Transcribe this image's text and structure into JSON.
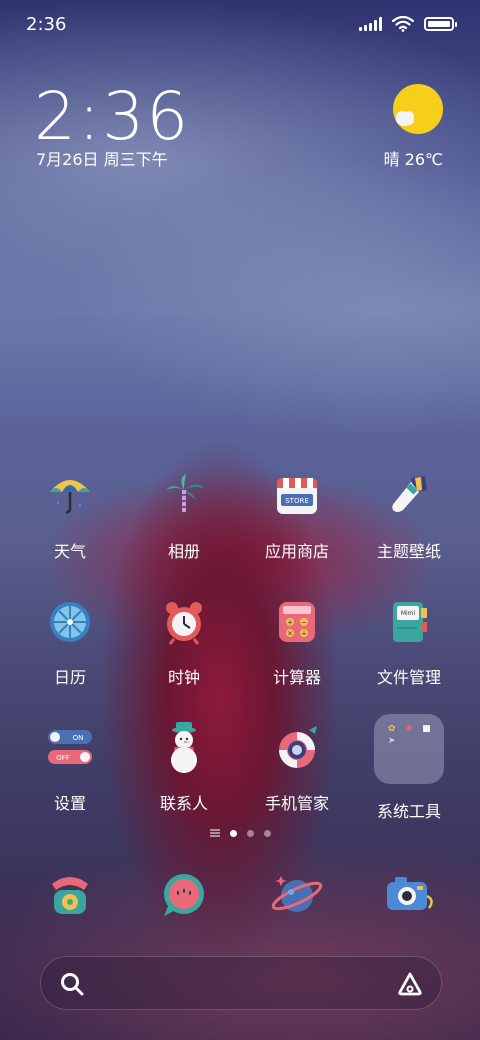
{
  "status": {
    "time": "2:36"
  },
  "clock": {
    "time": "2:36",
    "date": "7月26日 周三下午"
  },
  "weather": {
    "text": "晴 26℃",
    "icon": "sunny-cloud-icon"
  },
  "apps": [
    {
      "label": "天气",
      "icon": "umbrella-weather-icon"
    },
    {
      "label": "相册",
      "icon": "palm-tree-gallery-icon"
    },
    {
      "label": "应用商店",
      "icon": "store-icon"
    },
    {
      "label": "主题壁纸",
      "icon": "paint-brush-icon"
    },
    {
      "label": "日历",
      "icon": "lemon-calendar-icon"
    },
    {
      "label": "时钟",
      "icon": "alarm-clock-icon"
    },
    {
      "label": "计算器",
      "icon": "calculator-icon"
    },
    {
      "label": "文件管理",
      "icon": "notebook-files-icon"
    },
    {
      "label": "设置",
      "icon": "toggle-settings-icon",
      "toggles": [
        "ON",
        "OFF"
      ]
    },
    {
      "label": "联系人",
      "icon": "snowman-contacts-icon"
    },
    {
      "label": "手机管家",
      "icon": "lifebuoy-security-icon"
    },
    {
      "label": "系统工具",
      "icon": "folder-icon"
    }
  ],
  "dock": [
    {
      "name": "phone",
      "icon": "rotary-phone-icon"
    },
    {
      "name": "messages",
      "icon": "watermelon-message-icon"
    },
    {
      "name": "browser",
      "icon": "planet-browser-icon"
    },
    {
      "name": "camera",
      "icon": "camera-icon"
    }
  ],
  "colors": {
    "sun": "#f7cf1a",
    "accent_red": "#e25a5a",
    "teal": "#3aa6a0"
  }
}
